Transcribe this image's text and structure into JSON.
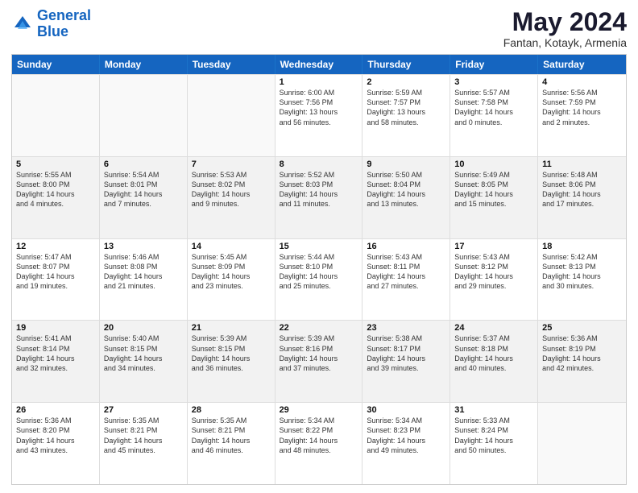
{
  "logo": {
    "line1": "General",
    "line2": "Blue"
  },
  "title": "May 2024",
  "subtitle": "Fantan, Kotayk, Armenia",
  "days": [
    "Sunday",
    "Monday",
    "Tuesday",
    "Wednesday",
    "Thursday",
    "Friday",
    "Saturday"
  ],
  "weeks": [
    [
      {
        "num": "",
        "lines": [],
        "empty": true
      },
      {
        "num": "",
        "lines": [],
        "empty": true
      },
      {
        "num": "",
        "lines": [],
        "empty": true
      },
      {
        "num": "1",
        "lines": [
          "Sunrise: 6:00 AM",
          "Sunset: 7:56 PM",
          "Daylight: 13 hours",
          "and 56 minutes."
        ]
      },
      {
        "num": "2",
        "lines": [
          "Sunrise: 5:59 AM",
          "Sunset: 7:57 PM",
          "Daylight: 13 hours",
          "and 58 minutes."
        ]
      },
      {
        "num": "3",
        "lines": [
          "Sunrise: 5:57 AM",
          "Sunset: 7:58 PM",
          "Daylight: 14 hours",
          "and 0 minutes."
        ]
      },
      {
        "num": "4",
        "lines": [
          "Sunrise: 5:56 AM",
          "Sunset: 7:59 PM",
          "Daylight: 14 hours",
          "and 2 minutes."
        ]
      }
    ],
    [
      {
        "num": "5",
        "lines": [
          "Sunrise: 5:55 AM",
          "Sunset: 8:00 PM",
          "Daylight: 14 hours",
          "and 4 minutes."
        ],
        "shaded": true
      },
      {
        "num": "6",
        "lines": [
          "Sunrise: 5:54 AM",
          "Sunset: 8:01 PM",
          "Daylight: 14 hours",
          "and 7 minutes."
        ],
        "shaded": true
      },
      {
        "num": "7",
        "lines": [
          "Sunrise: 5:53 AM",
          "Sunset: 8:02 PM",
          "Daylight: 14 hours",
          "and 9 minutes."
        ],
        "shaded": true
      },
      {
        "num": "8",
        "lines": [
          "Sunrise: 5:52 AM",
          "Sunset: 8:03 PM",
          "Daylight: 14 hours",
          "and 11 minutes."
        ],
        "shaded": true
      },
      {
        "num": "9",
        "lines": [
          "Sunrise: 5:50 AM",
          "Sunset: 8:04 PM",
          "Daylight: 14 hours",
          "and 13 minutes."
        ],
        "shaded": true
      },
      {
        "num": "10",
        "lines": [
          "Sunrise: 5:49 AM",
          "Sunset: 8:05 PM",
          "Daylight: 14 hours",
          "and 15 minutes."
        ],
        "shaded": true
      },
      {
        "num": "11",
        "lines": [
          "Sunrise: 5:48 AM",
          "Sunset: 8:06 PM",
          "Daylight: 14 hours",
          "and 17 minutes."
        ],
        "shaded": true
      }
    ],
    [
      {
        "num": "12",
        "lines": [
          "Sunrise: 5:47 AM",
          "Sunset: 8:07 PM",
          "Daylight: 14 hours",
          "and 19 minutes."
        ]
      },
      {
        "num": "13",
        "lines": [
          "Sunrise: 5:46 AM",
          "Sunset: 8:08 PM",
          "Daylight: 14 hours",
          "and 21 minutes."
        ]
      },
      {
        "num": "14",
        "lines": [
          "Sunrise: 5:45 AM",
          "Sunset: 8:09 PM",
          "Daylight: 14 hours",
          "and 23 minutes."
        ]
      },
      {
        "num": "15",
        "lines": [
          "Sunrise: 5:44 AM",
          "Sunset: 8:10 PM",
          "Daylight: 14 hours",
          "and 25 minutes."
        ]
      },
      {
        "num": "16",
        "lines": [
          "Sunrise: 5:43 AM",
          "Sunset: 8:11 PM",
          "Daylight: 14 hours",
          "and 27 minutes."
        ]
      },
      {
        "num": "17",
        "lines": [
          "Sunrise: 5:43 AM",
          "Sunset: 8:12 PM",
          "Daylight: 14 hours",
          "and 29 minutes."
        ]
      },
      {
        "num": "18",
        "lines": [
          "Sunrise: 5:42 AM",
          "Sunset: 8:13 PM",
          "Daylight: 14 hours",
          "and 30 minutes."
        ]
      }
    ],
    [
      {
        "num": "19",
        "lines": [
          "Sunrise: 5:41 AM",
          "Sunset: 8:14 PM",
          "Daylight: 14 hours",
          "and 32 minutes."
        ],
        "shaded": true
      },
      {
        "num": "20",
        "lines": [
          "Sunrise: 5:40 AM",
          "Sunset: 8:15 PM",
          "Daylight: 14 hours",
          "and 34 minutes."
        ],
        "shaded": true
      },
      {
        "num": "21",
        "lines": [
          "Sunrise: 5:39 AM",
          "Sunset: 8:15 PM",
          "Daylight: 14 hours",
          "and 36 minutes."
        ],
        "shaded": true
      },
      {
        "num": "22",
        "lines": [
          "Sunrise: 5:39 AM",
          "Sunset: 8:16 PM",
          "Daylight: 14 hours",
          "and 37 minutes."
        ],
        "shaded": true
      },
      {
        "num": "23",
        "lines": [
          "Sunrise: 5:38 AM",
          "Sunset: 8:17 PM",
          "Daylight: 14 hours",
          "and 39 minutes."
        ],
        "shaded": true
      },
      {
        "num": "24",
        "lines": [
          "Sunrise: 5:37 AM",
          "Sunset: 8:18 PM",
          "Daylight: 14 hours",
          "and 40 minutes."
        ],
        "shaded": true
      },
      {
        "num": "25",
        "lines": [
          "Sunrise: 5:36 AM",
          "Sunset: 8:19 PM",
          "Daylight: 14 hours",
          "and 42 minutes."
        ],
        "shaded": true
      }
    ],
    [
      {
        "num": "26",
        "lines": [
          "Sunrise: 5:36 AM",
          "Sunset: 8:20 PM",
          "Daylight: 14 hours",
          "and 43 minutes."
        ]
      },
      {
        "num": "27",
        "lines": [
          "Sunrise: 5:35 AM",
          "Sunset: 8:21 PM",
          "Daylight: 14 hours",
          "and 45 minutes."
        ]
      },
      {
        "num": "28",
        "lines": [
          "Sunrise: 5:35 AM",
          "Sunset: 8:21 PM",
          "Daylight: 14 hours",
          "and 46 minutes."
        ]
      },
      {
        "num": "29",
        "lines": [
          "Sunrise: 5:34 AM",
          "Sunset: 8:22 PM",
          "Daylight: 14 hours",
          "and 48 minutes."
        ]
      },
      {
        "num": "30",
        "lines": [
          "Sunrise: 5:34 AM",
          "Sunset: 8:23 PM",
          "Daylight: 14 hours",
          "and 49 minutes."
        ]
      },
      {
        "num": "31",
        "lines": [
          "Sunrise: 5:33 AM",
          "Sunset: 8:24 PM",
          "Daylight: 14 hours",
          "and 50 minutes."
        ]
      },
      {
        "num": "",
        "lines": [],
        "empty": true
      }
    ]
  ]
}
